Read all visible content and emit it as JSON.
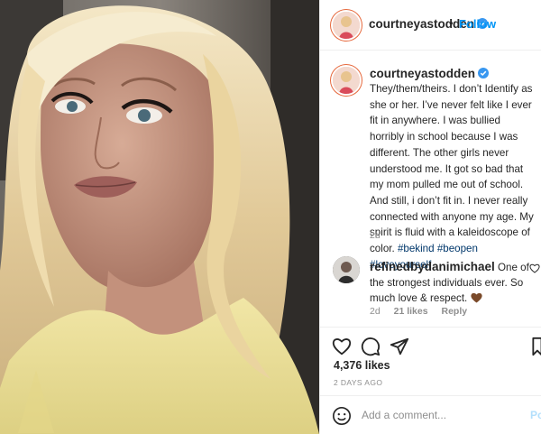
{
  "header": {
    "username": "courtneyastodden",
    "separator": "•",
    "follow_label": "Follow"
  },
  "caption": {
    "username": "courtneyastodden",
    "text": "They/them/theirs. I don’t Identify as she or her. I’ve never felt like I ever fit in anywhere. I was bullied horribly in school because I was different. The other girls never understood me. It got so bad that my mom pulled me out of school. And still, i don’t fit in. I never really connected with anyone my age. My spirit is fluid with a kaleidoscope of color.",
    "hashtags": [
      "#bekind",
      "#beopen",
      "#loveyourself"
    ],
    "age": "2d"
  },
  "comment": {
    "username": "refinedbydanimichael",
    "text": "One of the strongest individuals ever. So much love & respect.",
    "age": "2d",
    "likes": "21 likes",
    "reply_label": "Reply"
  },
  "post": {
    "likes": "4,376 likes",
    "timestamp": "2 DAYS AGO"
  },
  "add_comment": {
    "placeholder": "Add a comment...",
    "post_label": "Po"
  },
  "icons": {
    "verified": "verified-badge-icon",
    "like": "heart-icon",
    "comment": "comment-icon",
    "share": "paper-plane-icon",
    "save": "bookmark-icon",
    "emoji": "smiley-icon",
    "comment_like": "small-heart-icon",
    "emoji_in_comment": "brown-heart-emoji"
  },
  "colors": {
    "accent_blue": "#0095f6",
    "hashtag_blue": "#00376b",
    "muted_gray": "#8e8e8e",
    "border": "#efefef"
  }
}
